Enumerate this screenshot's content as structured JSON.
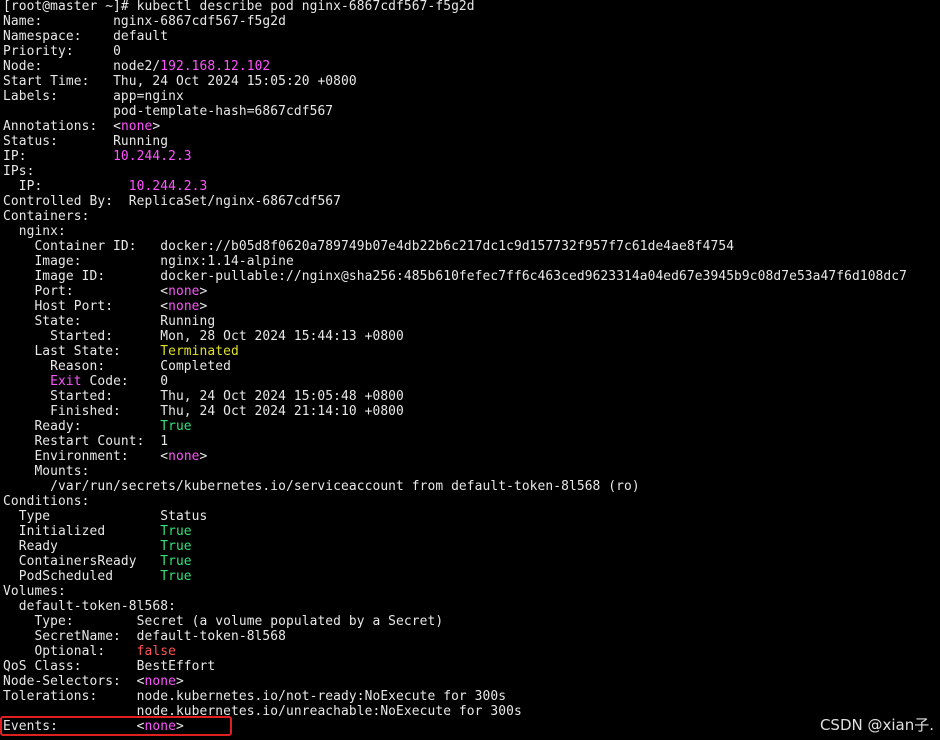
{
  "terminal": {
    "lines": [
      [
        {
          "t": "[root@master ~]# kubectl describe pod nginx-6867cdf567-f5g2d",
          "c": "white"
        }
      ],
      [
        {
          "t": "Name:         ",
          "c": "white"
        },
        {
          "t": "nginx-6867cdf567-f5g2d",
          "c": "white"
        }
      ],
      [
        {
          "t": "Namespace:    ",
          "c": "white"
        },
        {
          "t": "default",
          "c": "white"
        }
      ],
      [
        {
          "t": "Priority:     ",
          "c": "white"
        },
        {
          "t": "0",
          "c": "white"
        }
      ],
      [
        {
          "t": "Node:         ",
          "c": "white"
        },
        {
          "t": "node2/",
          "c": "white"
        },
        {
          "t": "192.168.12.102",
          "c": "magenta"
        }
      ],
      [
        {
          "t": "Start Time:   ",
          "c": "white"
        },
        {
          "t": "Thu, 24 Oct 2024 15:05:20 +0800",
          "c": "white"
        }
      ],
      [
        {
          "t": "Labels:       ",
          "c": "white"
        },
        {
          "t": "app=nginx",
          "c": "white"
        }
      ],
      [
        {
          "t": "              ",
          "c": "white"
        },
        {
          "t": "pod-template-hash=6867cdf567",
          "c": "white"
        }
      ],
      [
        {
          "t": "Annotations:  ",
          "c": "white"
        },
        {
          "t": "<",
          "c": "white"
        },
        {
          "t": "none",
          "c": "magenta"
        },
        {
          "t": ">",
          "c": "white"
        }
      ],
      [
        {
          "t": "Status:       ",
          "c": "white"
        },
        {
          "t": "Running",
          "c": "white"
        }
      ],
      [
        {
          "t": "IP:           ",
          "c": "white"
        },
        {
          "t": "10.244.2.3",
          "c": "magenta"
        }
      ],
      [
        {
          "t": "IPs:",
          "c": "white"
        }
      ],
      [
        {
          "t": "  IP:           ",
          "c": "white"
        },
        {
          "t": "10.244.2.3",
          "c": "magenta"
        }
      ],
      [
        {
          "t": "Controlled By:  ",
          "c": "white"
        },
        {
          "t": "ReplicaSet/nginx-6867cdf567",
          "c": "white"
        }
      ],
      [
        {
          "t": "Containers:",
          "c": "white"
        }
      ],
      [
        {
          "t": "  nginx:",
          "c": "white"
        }
      ],
      [
        {
          "t": "    Container ID:   ",
          "c": "white"
        },
        {
          "t": "docker://b05d8f0620a789749b07e4db22b6c217dc1c9d157732f957f7c61de4ae8f4754",
          "c": "white"
        }
      ],
      [
        {
          "t": "    Image:          ",
          "c": "white"
        },
        {
          "t": "nginx:1.14-alpine",
          "c": "white"
        }
      ],
      [
        {
          "t": "    Image ID:       ",
          "c": "white"
        },
        {
          "t": "docker-pullable://nginx@sha256:485b610fefec7ff6c463ced9623314a04ed67e3945b9c08d7e53a47f6d108dc7",
          "c": "white"
        }
      ],
      [
        {
          "t": "    Port:           ",
          "c": "white"
        },
        {
          "t": "<",
          "c": "white"
        },
        {
          "t": "none",
          "c": "magenta"
        },
        {
          "t": ">",
          "c": "white"
        }
      ],
      [
        {
          "t": "    Host Port:      ",
          "c": "white"
        },
        {
          "t": "<",
          "c": "white"
        },
        {
          "t": "none",
          "c": "magenta"
        },
        {
          "t": ">",
          "c": "white"
        }
      ],
      [
        {
          "t": "    State:          ",
          "c": "white"
        },
        {
          "t": "Running",
          "c": "white"
        }
      ],
      [
        {
          "t": "      Started:      ",
          "c": "white"
        },
        {
          "t": "Mon, 28 Oct 2024 15:44:13 +0800",
          "c": "white"
        }
      ],
      [
        {
          "t": "    Last State:     ",
          "c": "white"
        },
        {
          "t": "Terminated",
          "c": "yellow"
        }
      ],
      [
        {
          "t": "      Reason:       ",
          "c": "white"
        },
        {
          "t": "Completed",
          "c": "white"
        }
      ],
      [
        {
          "t": "      ",
          "c": "white"
        },
        {
          "t": "Exit",
          "c": "magenta"
        },
        {
          "t": " Code:    ",
          "c": "white"
        },
        {
          "t": "0",
          "c": "white"
        }
      ],
      [
        {
          "t": "      Started:      ",
          "c": "white"
        },
        {
          "t": "Thu, 24 Oct 2024 15:05:48 +0800",
          "c": "white"
        }
      ],
      [
        {
          "t": "      Finished:     ",
          "c": "white"
        },
        {
          "t": "Thu, 24 Oct 2024 21:14:10 +0800",
          "c": "white"
        }
      ],
      [
        {
          "t": "    Ready:          ",
          "c": "white"
        },
        {
          "t": "True",
          "c": "green"
        }
      ],
      [
        {
          "t": "    Restart Count:  ",
          "c": "white"
        },
        {
          "t": "1",
          "c": "white"
        }
      ],
      [
        {
          "t": "    Environment:    ",
          "c": "white"
        },
        {
          "t": "<",
          "c": "white"
        },
        {
          "t": "none",
          "c": "magenta"
        },
        {
          "t": ">",
          "c": "white"
        }
      ],
      [
        {
          "t": "    Mounts:",
          "c": "white"
        }
      ],
      [
        {
          "t": "      /var/run/secrets/kubernetes.io/serviceaccount from default-token-8l568 (ro)",
          "c": "white"
        }
      ],
      [
        {
          "t": "Conditions:",
          "c": "white"
        }
      ],
      [
        {
          "t": "  Type              ",
          "c": "white"
        },
        {
          "t": "Status",
          "c": "white"
        }
      ],
      [
        {
          "t": "  Initialized       ",
          "c": "white"
        },
        {
          "t": "True",
          "c": "green"
        }
      ],
      [
        {
          "t": "  Ready             ",
          "c": "white"
        },
        {
          "t": "True",
          "c": "green"
        }
      ],
      [
        {
          "t": "  ContainersReady   ",
          "c": "white"
        },
        {
          "t": "True",
          "c": "green"
        }
      ],
      [
        {
          "t": "  PodScheduled      ",
          "c": "white"
        },
        {
          "t": "True",
          "c": "green"
        }
      ],
      [
        {
          "t": "Volumes:",
          "c": "white"
        }
      ],
      [
        {
          "t": "  default-token-8l568:",
          "c": "white"
        }
      ],
      [
        {
          "t": "    Type:        ",
          "c": "white"
        },
        {
          "t": "Secret (a volume populated by a Secret)",
          "c": "white"
        }
      ],
      [
        {
          "t": "    SecretName:  ",
          "c": "white"
        },
        {
          "t": "default-token-8l568",
          "c": "white"
        }
      ],
      [
        {
          "t": "    Optional:    ",
          "c": "white"
        },
        {
          "t": "false",
          "c": "red"
        }
      ],
      [
        {
          "t": "QoS Class:       ",
          "c": "white"
        },
        {
          "t": "BestEffort",
          "c": "white"
        }
      ],
      [
        {
          "t": "Node-Selectors:  ",
          "c": "white"
        },
        {
          "t": "<",
          "c": "white"
        },
        {
          "t": "none",
          "c": "magenta"
        },
        {
          "t": ">",
          "c": "white"
        }
      ],
      [
        {
          "t": "Tolerations:     ",
          "c": "white"
        },
        {
          "t": "node.kubernetes.io/not-ready:NoExecute for 300s",
          "c": "white"
        }
      ],
      [
        {
          "t": "                 ",
          "c": "white"
        },
        {
          "t": "node.kubernetes.io/unreachable:NoExecute for 300s",
          "c": "white"
        }
      ],
      [
        {
          "t": "Events:          ",
          "c": "white"
        },
        {
          "t": "<",
          "c": "white"
        },
        {
          "t": "none",
          "c": "magenta"
        },
        {
          "t": ">",
          "c": "white"
        }
      ]
    ]
  },
  "watermark": "CSDN @xian子.",
  "colors": {
    "background": "#000000",
    "text": "#e8e8e8",
    "magenta": "#ff55ff",
    "green": "#34e27a",
    "yellow": "#e0e028",
    "red": "#ff5555",
    "highlight": "#e02020"
  }
}
